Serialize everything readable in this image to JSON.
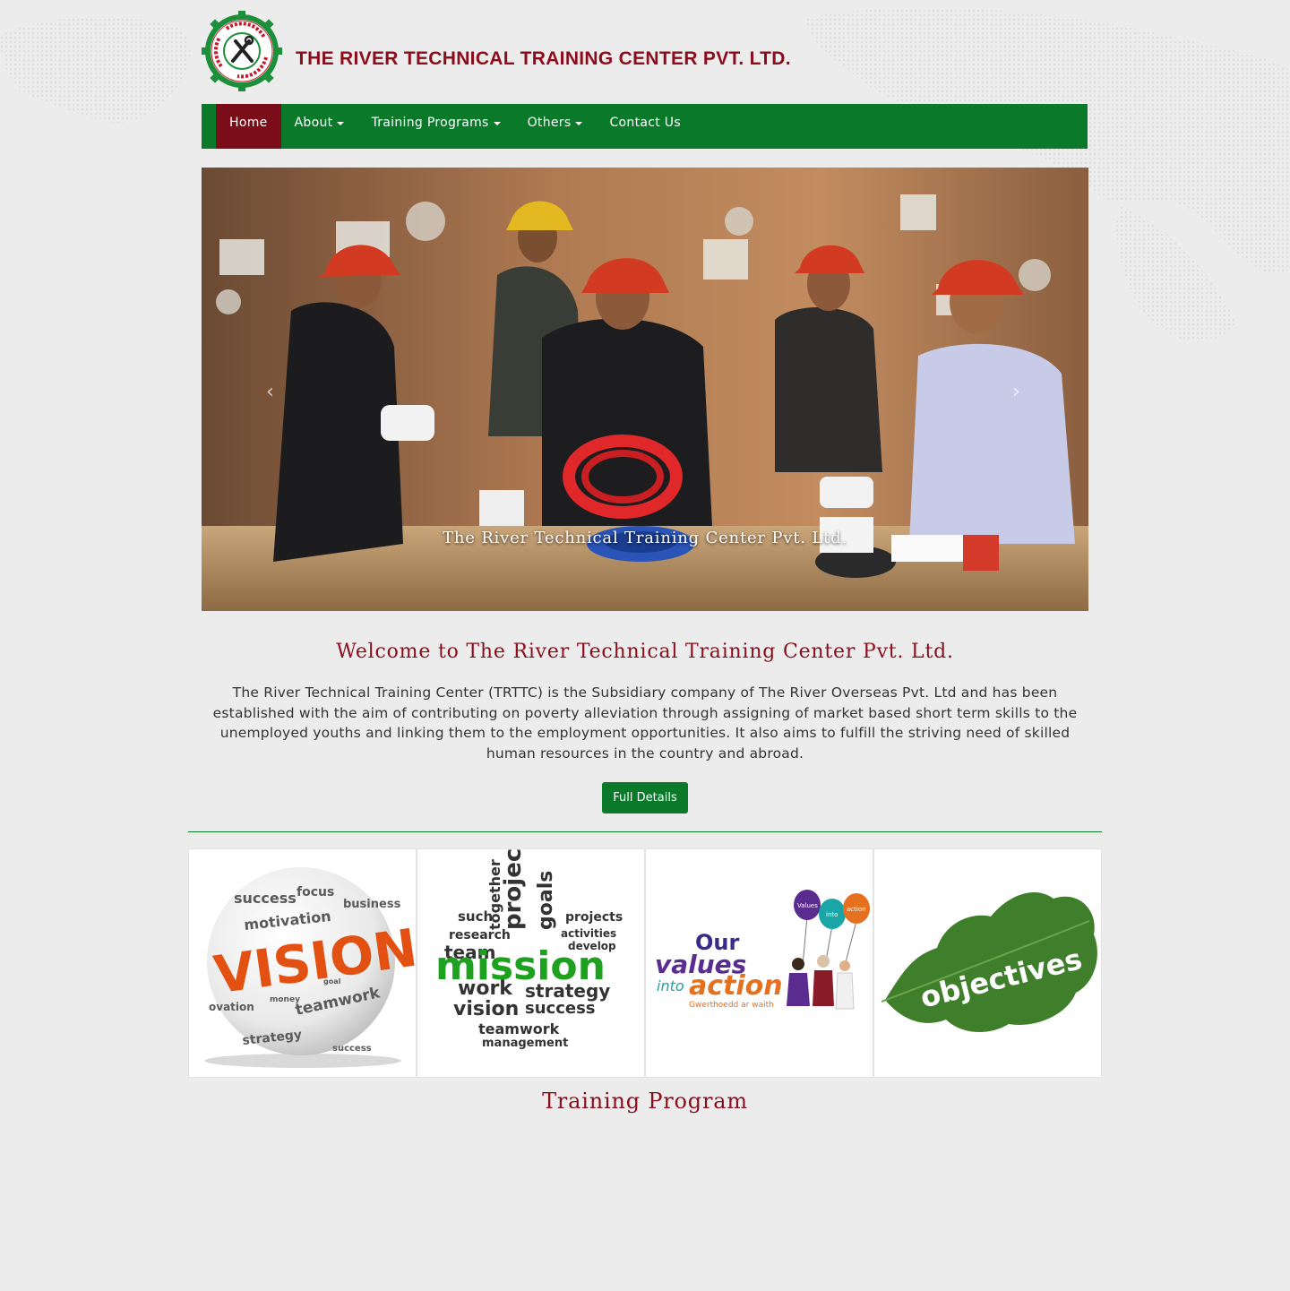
{
  "header": {
    "title": "THE RIVER TECHNICAL TRAINING CENTER PVT. LTD.",
    "logo_ring_text": "The River Technical Training Center",
    "logo_icon": "tools-gear-logo"
  },
  "nav": {
    "items": [
      {
        "label": "Home",
        "active": true,
        "dropdown": false
      },
      {
        "label": "About",
        "active": false,
        "dropdown": true
      },
      {
        "label": "Training Programs",
        "active": false,
        "dropdown": true
      },
      {
        "label": "Others",
        "active": false,
        "dropdown": true
      },
      {
        "label": "Contact Us",
        "active": false,
        "dropdown": false
      }
    ]
  },
  "carousel": {
    "caption": "The River Technical Training Center Pvt. Ltd.",
    "prev_icon": "chevron-left-icon",
    "next_icon": "chevron-right-icon"
  },
  "welcome": {
    "title": "Welcome to The River Technical Training Center Pvt. Ltd.",
    "text": "The River Technical Training Center (TRTTC) is the Subsidiary company of The River Overseas Pvt. Ltd and has been established with the aim of contributing on poverty alleviation through assigning of market based short term skills to the unemployed youths and linking them to the employment opportunities. It also aims to fulfill the striving need of skilled human resources in the country and abroad.",
    "button_label": "Full Details"
  },
  "tiles": {
    "vision": {
      "main_word": "VISION"
    },
    "mission": {
      "main_word": "mission"
    },
    "values": {
      "line1": "Our",
      "line2": "values",
      "line3": "into",
      "line4": "action",
      "tagline": "Gwerthoedd ar waith",
      "balloon1": "Values",
      "balloon2": "into",
      "balloon3": "action"
    },
    "objectives": {
      "main_word": "objectives"
    }
  },
  "training": {
    "title": "Training Program"
  },
  "colors": {
    "brand_red": "#8b0d1c",
    "brand_green": "#0a7a2a",
    "page_bg": "#ececec"
  }
}
